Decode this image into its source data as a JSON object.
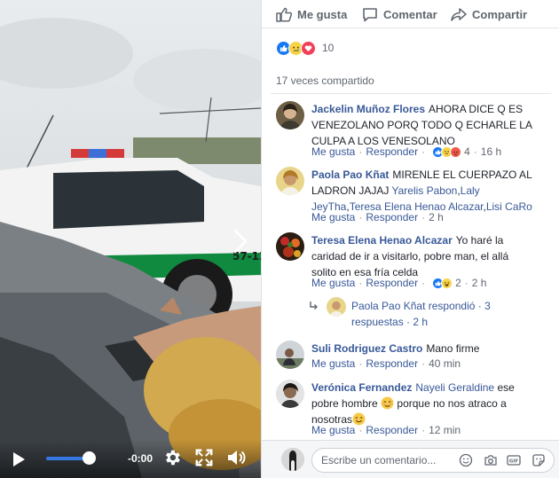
{
  "video": {
    "time_label": "-0:00",
    "volume_level": 0.85,
    "icons": [
      "play-icon",
      "gear-icon",
      "fullscreen-icon",
      "speaker-icon",
      "chevron-right-icon"
    ],
    "patrol_car_text": [
      "IA",
      "57-12"
    ]
  },
  "actions": {
    "like_label": "Me gusta",
    "comment_label": "Comentar",
    "share_label": "Compartir"
  },
  "reactions": {
    "icons": [
      "like-icon",
      "sad-icon",
      "love-icon"
    ],
    "count": "10"
  },
  "shares": "17 veces compartido",
  "comments": [
    {
      "name": "Jackelin Muñoz Flores",
      "text": "AHORA DICE Q ES VENEZOLANO PORQ TODO Q ECHARLE LA CULPA A LOS VENESOLANO",
      "like": "Me gusta",
      "reply": "Responder",
      "reaction_count": "4",
      "time": "16 h"
    },
    {
      "name": "Paola Pao Kñat",
      "text": "MIRENLE EL CUERPAZO AL LADRON JAJAJ",
      "tags": [
        "Yarelis Pabon",
        "Laly JeyTha",
        "Teresa Elena Henao Alcazar",
        "Lisi CaRo"
      ],
      "like": "Me gusta",
      "reply": "Responder",
      "time": "2 h"
    },
    {
      "name": "Teresa Elena Henao Alcazar",
      "text": "Yo haré la caridad de ir a visitarlo, pobre man, el allá solito en esa fría celda",
      "like": "Me gusta",
      "reply": "Responder",
      "reaction_count": "2",
      "time": "2 h",
      "reply_summary": "Paola Pao Kñat respondió · 3 respuestas · 2 h"
    },
    {
      "name": "Suli Rodriguez Castro",
      "text": "Mano firme",
      "like": "Me gusta",
      "reply": "Responder",
      "time": "40 min"
    },
    {
      "name": "Verónica Fernandez",
      "tag": "Nayeli Geraldine",
      "text_1": "ese pobre hombre",
      "text_2": "porque no nos atraco a nosotras",
      "like": "Me gusta",
      "reply": "Responder",
      "time": "12 min"
    }
  ],
  "composer": {
    "placeholder": "Escribe un comentario...",
    "gif_label": "GIF",
    "icons": [
      "emoji-icon",
      "camera-icon",
      "gif-icon",
      "sticker-icon"
    ]
  },
  "colors": {
    "link": "#385898",
    "meta": "#606770",
    "like_blue": "#1877f2",
    "love_red": "#f33e58",
    "sad_yellow": "#f7d348",
    "volume_blue": "#3578e5"
  }
}
